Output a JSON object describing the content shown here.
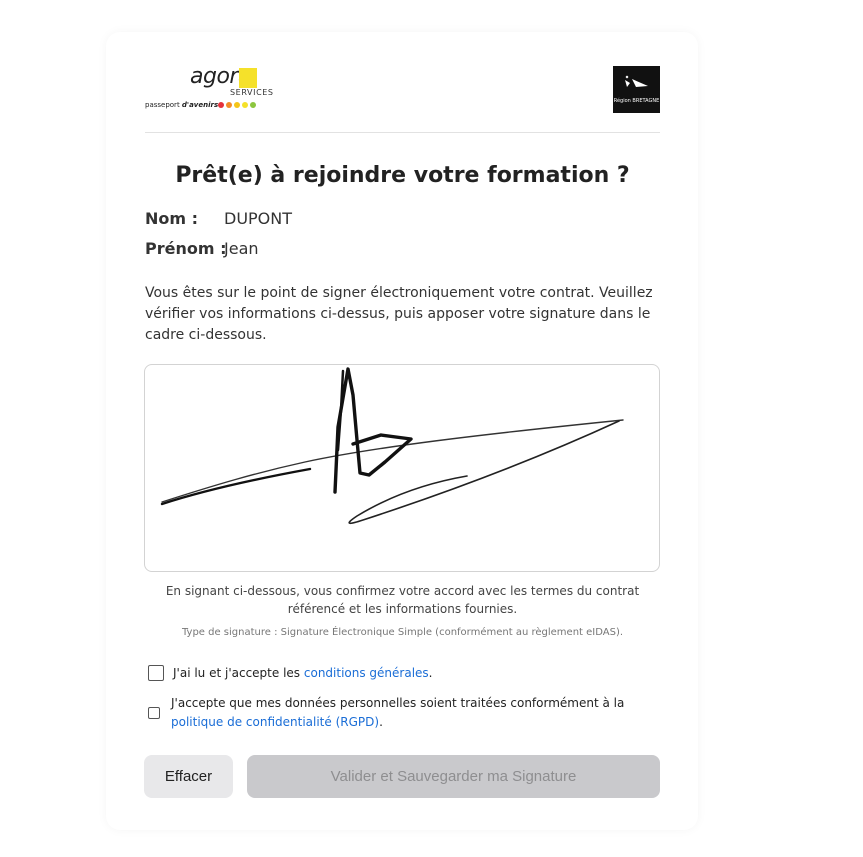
{
  "header": {
    "agora_logo": {
      "word": "agora",
      "sub": "SERVICES",
      "tagline_prefix": "passeport ",
      "tagline_bold": "d'avenirs"
    },
    "region_logo": {
      "text": "Région BRETAGNE"
    }
  },
  "title": "Prêt(e) à rejoindre votre formation ?",
  "fields": {
    "nom_label": "Nom :",
    "nom_value": "DUPONT",
    "prenom_label": "Prénom :",
    "prenom_value": "Jean"
  },
  "intro_text": "Vous êtes sur le point de signer électroniquement votre contrat. Veuillez vérifier vos informations ci-dessus, puis apposer votre signature dans le cadre ci-dessous.",
  "consent_text": "En signant ci-dessous, vous confirmez votre accord avec les termes du contrat référencé et les informations fournies.",
  "signature_type": "Type de signature : Signature Électronique Simple (conformément au règlement eIDAS).",
  "checkboxes": {
    "cgu": {
      "prefix": "J'ai lu et j'accepte les ",
      "link": "conditions générales",
      "suffix": ".",
      "checked": false
    },
    "rgpd": {
      "prefix": "J'accepte que mes données personnelles soient traitées conformément à la ",
      "link": "politique de confidentialité (RGPD)",
      "suffix": ".",
      "checked": false
    }
  },
  "buttons": {
    "clear": "Effacer",
    "save": "Valider et Sauvegarder ma Signature"
  },
  "colors": {
    "link": "#1a6dd6",
    "agora_yellow": "#f5e12a",
    "disabled_button": "#c9c9cc",
    "dots": [
      "#e5313b",
      "#f28c28",
      "#f5c518",
      "#f5e12a",
      "#8cc63f"
    ]
  }
}
